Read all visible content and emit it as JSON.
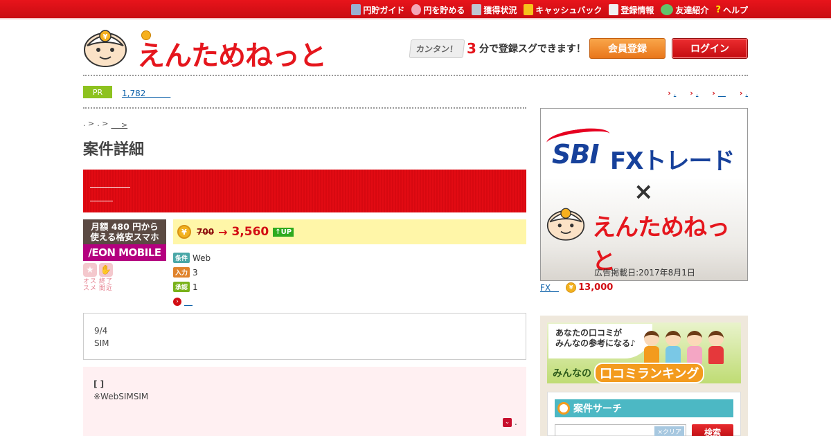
{
  "topnav": {
    "items": [
      {
        "label": "円貯ガイド",
        "icon": "book-icon",
        "color": "#9ab0d2"
      },
      {
        "label": "円を貯める",
        "icon": "piggy-bank-icon",
        "color": "#f4a6b8"
      },
      {
        "label": "獲得状況",
        "icon": "calendar-icon",
        "color": "#bfc6d2"
      },
      {
        "label": "キャッシュバック",
        "icon": "coin-stack-icon",
        "color": "#f6c21c"
      },
      {
        "label": "登録情報",
        "icon": "document-icon",
        "color": "#f0f0f0"
      },
      {
        "label": "友達紹介",
        "icon": "chat-bubble-icon",
        "color": "#60c46a"
      },
      {
        "label": "ヘルプ",
        "icon": "question-icon",
        "color": "#ffe600"
      }
    ]
  },
  "header": {
    "brand": "えんためねっと",
    "tagline_kantan": "カンタン！",
    "tagline_num": "3",
    "tagline_rest": "分で登録スグできます！",
    "register_label": "会員登録",
    "login_label": "ログイン"
  },
  "pr": {
    "badge": "PR",
    "link": "1,782　　　",
    "quick_links": [
      {
        "arrow": "›",
        "label": "."
      },
      {
        "arrow": "›",
        "label": "."
      },
      {
        "arrow": "›",
        "label": "　"
      },
      {
        "arrow": "›",
        "label": "."
      }
    ]
  },
  "breadcrumb": [
    ". >",
    ". >",
    "　 >"
  ],
  "page": {
    "title": "案件詳細"
  },
  "offer": {
    "tile_top": "月額 480 円から\n使える格安スマホ",
    "tile_brand": "/EON MOBILE",
    "fav_labels": [
      "オススメ",
      "終了間近"
    ],
    "coin_symbol": "¥",
    "old_points": "700",
    "arrow": "→",
    "new_points": "3,560",
    "up_label": "↑UP",
    "conditions": [
      {
        "tag": "条件",
        "value": "Web"
      },
      {
        "tag": "入力",
        "value": "3"
      },
      {
        "tag": "承認",
        "value": "1"
      }
    ],
    "more_link": "　"
  },
  "note": {
    "line1": "9/4",
    "line2": "SIM"
  },
  "detail": {
    "heading": "[ ]",
    "text": "※WebSIMSIM",
    "toggle_label": "."
  },
  "ad": {
    "sbi": "SBI",
    "fx": "FXトレード",
    "times": "×",
    "brand": "えんためねっと",
    "date": "広告掲載日:2017年8月1日",
    "caption_link": "FX　",
    "caption_points": "13,000"
  },
  "side": {
    "kuchikomi_line1": "あなたの口コミが",
    "kuchikomi_line2": "みんなの参考になる♪",
    "rank_pre": "みんなの",
    "rank_main": "口コミランキング",
    "search_title": "案件サーチ",
    "clear_label": "×クリア",
    "search_button": "検索"
  }
}
